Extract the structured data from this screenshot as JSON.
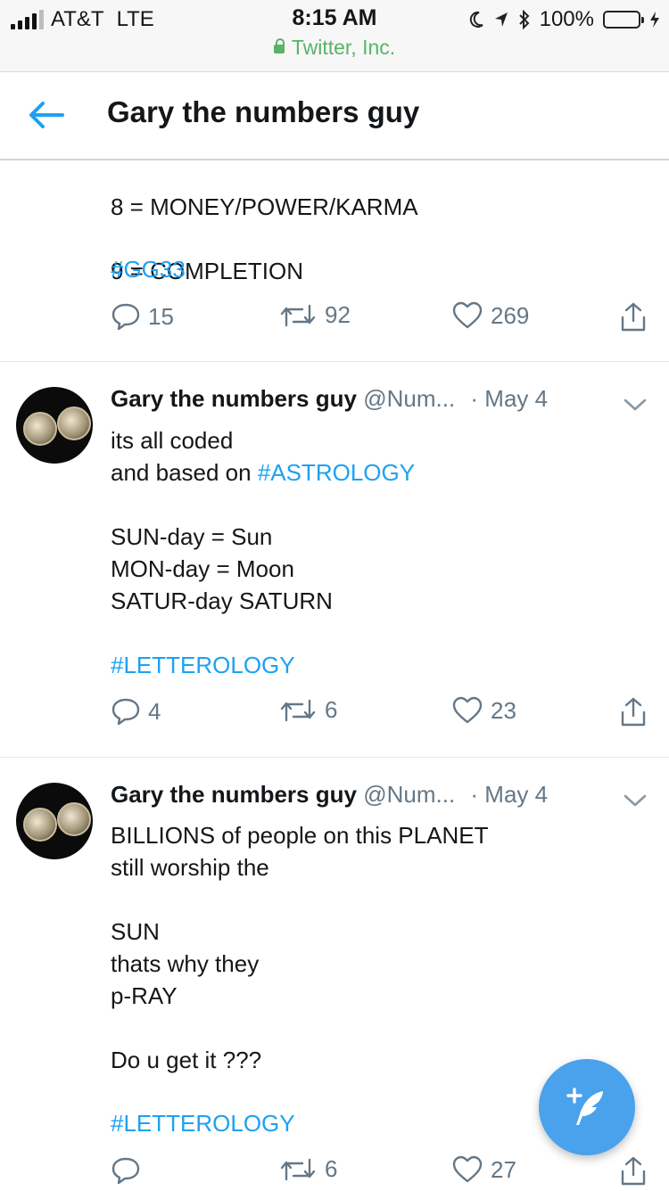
{
  "status_bar": {
    "carrier": "AT&T",
    "network": "LTE",
    "time": "8:15 AM",
    "url": "Twitter, Inc.",
    "battery_percent": "100%",
    "battery_level": 1.0,
    "signal_bars": 4,
    "signal_total": 5
  },
  "header": {
    "title": "Gary the numbers guy",
    "back_icon": "arrow-left-icon"
  },
  "colors": {
    "accent": "#1da1f2",
    "secure_green": "#58b368",
    "fab": "#4aa1ec"
  },
  "tweets": [
    {
      "partial": true,
      "lines": [
        "8 = MONEY/POWER/KARMA",
        "9 = COMPLETION"
      ],
      "hashtag": "#GG33",
      "replies": "15",
      "retweets": "92",
      "likes": "269"
    },
    {
      "name": "Gary the numbers guy",
      "handle": "@Num...",
      "date": "· May 4",
      "text_a": "its all coded\nand based on ",
      "text_hashtag": "#ASTROLOGY",
      "text_b": "SUN-day  = Sun\nMON-day  = Moon\nSATUR-day SATURN",
      "hashtag": "#LETTEROLOGY",
      "replies": "4",
      "retweets": "6",
      "likes": "23"
    },
    {
      "name": "Gary the numbers guy",
      "handle": "@Num...",
      "date": "· May 4",
      "text": "BILLIONS of people on this PLANET\nstill worship the\n\nSUN\nthats why they\np-RAY\n\nDo u get it ???",
      "hashtag": "#LETTEROLOGY",
      "replies": "",
      "retweets": "6",
      "likes": "27"
    }
  ],
  "fab": {
    "icon": "compose-tweet-icon"
  }
}
